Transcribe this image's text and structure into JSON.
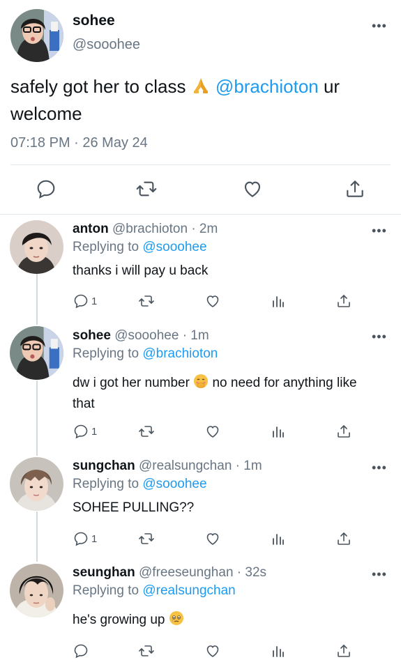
{
  "main_tweet": {
    "name": "sohee",
    "handle": "@sooohee",
    "text_before": "safely got her to class ",
    "mention": "@brachioton",
    "text_after": " ur welcome",
    "timestamp": "07:18 PM · 26 May 24",
    "emoji": "folded-hands",
    "actions": [
      "reply-icon",
      "retweet-icon",
      "like-icon",
      "share-icon"
    ]
  },
  "replies": [
    {
      "name": "anton",
      "handle": "@brachioton",
      "time": "· 2m",
      "replying_to_label": "Replying to",
      "replying_to": "@sooohee",
      "text": "thanks i will pay u back",
      "reply_count": "1"
    },
    {
      "name": "sohee",
      "handle": "@sooohee",
      "time": "· 1m",
      "replying_to_label": "Replying to",
      "replying_to": "@brachioton",
      "text_before": "dw i got her number ",
      "text_after": "  no need for anything like that",
      "emoji": "smiling-face-hand-over-mouth",
      "reply_count": "1"
    },
    {
      "name": "sungchan",
      "handle": "@realsungchan",
      "time": "· 1m",
      "replying_to_label": "Replying to",
      "replying_to": "@sooohee",
      "text": "SOHEE PULLING??",
      "reply_count": "1"
    },
    {
      "name": "seunghan",
      "handle": "@freeseunghan",
      "time": "· 32s",
      "replying_to_label": "Replying to",
      "replying_to": "@realsungchan",
      "text_before": "he's growing up ",
      "emoji": "face-holding-back-tears",
      "reply_count": ""
    }
  ],
  "more_label": "•••",
  "colors": {
    "accent": "#1d9bf0",
    "muted": "#687684",
    "icon": "#4a545e",
    "divider": "#e1e8ed"
  }
}
